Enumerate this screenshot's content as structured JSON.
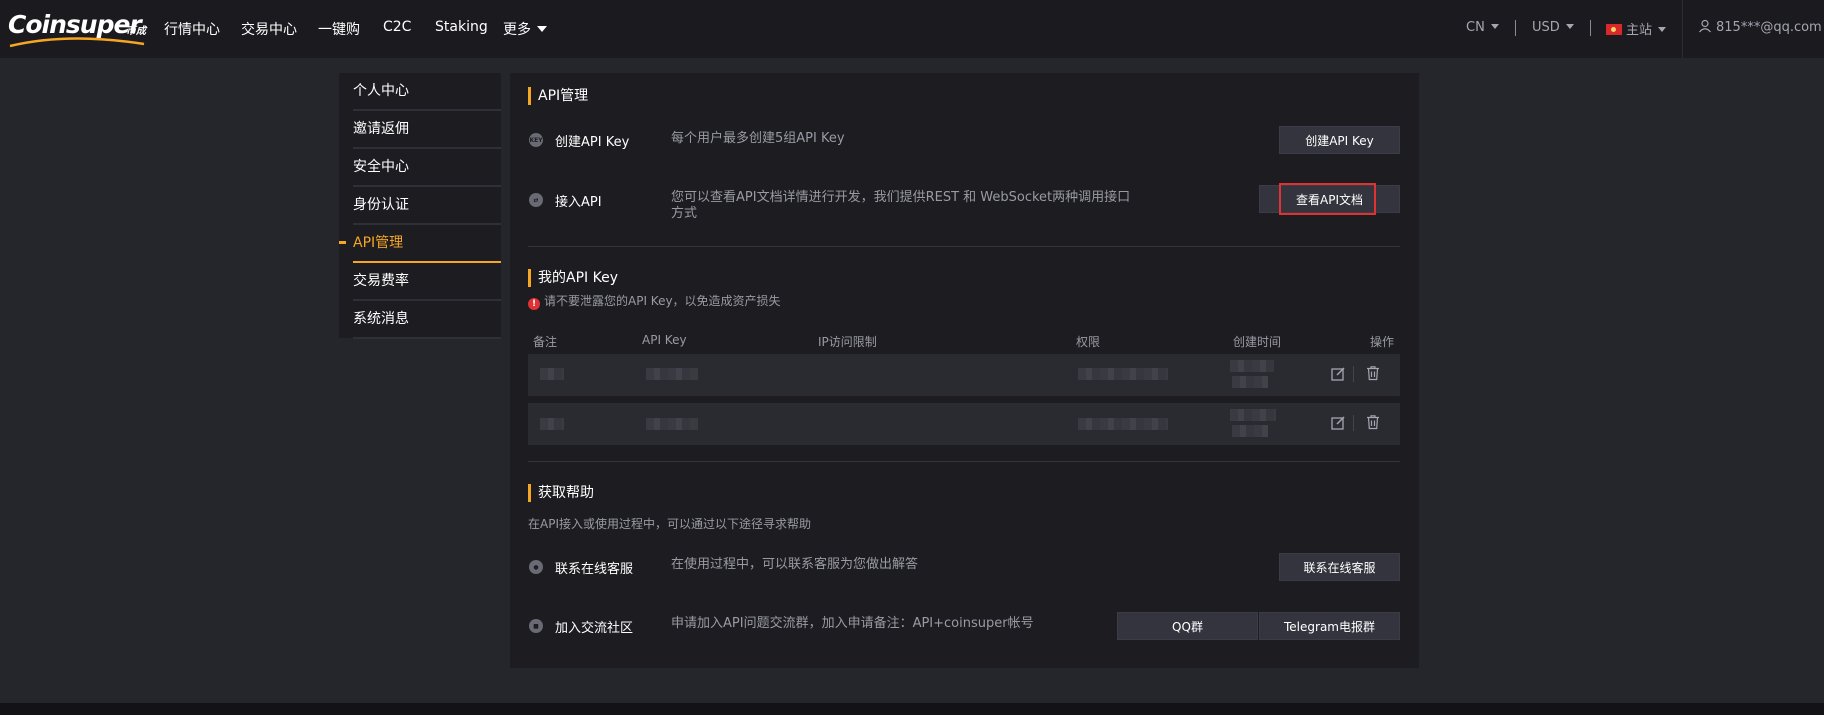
{
  "brand": {
    "logo_text": "Coinsuper",
    "logo_sub": "币成"
  },
  "nav": {
    "items": [
      "行情中心",
      "交易中心",
      "一键购",
      "C2C",
      "Staking",
      "更多"
    ],
    "language": "CN",
    "currency": "USD",
    "site": "主站",
    "user": "815***@qq.com"
  },
  "sidebar": {
    "items": [
      {
        "label": "个人中心"
      },
      {
        "label": "邀请返佣"
      },
      {
        "label": "安全中心"
      },
      {
        "label": "身份认证"
      },
      {
        "label": "API管理"
      },
      {
        "label": "交易费率"
      },
      {
        "label": "系统消息"
      }
    ],
    "active": "API管理"
  },
  "api_section": {
    "title": "API管理",
    "create": {
      "label": "创建API Key",
      "desc": "每个用户最多创建5组API Key",
      "button": "创建API Key"
    },
    "access": {
      "label": "接入API",
      "desc": "您可以查看API文档详情进行开发，我们提供REST 和 WebSocket两种调用接口方式",
      "button": "查看API文档"
    }
  },
  "my_keys": {
    "title": "我的API Key",
    "warning": "请不要泄露您的API Key，以免造成资产损失",
    "columns": [
      "备注",
      "API Key",
      "IP访问限制",
      "权限",
      "创建时间",
      "操作"
    ],
    "rows": [
      {
        "note": "",
        "key": "",
        "ip": "",
        "perm": "",
        "time": ""
      },
      {
        "note": "",
        "key": "",
        "ip": "",
        "perm": "",
        "time": ""
      }
    ]
  },
  "help": {
    "title": "获取帮助",
    "desc": "在API接入或使用过程中，可以通过以下途径寻求帮助",
    "support": {
      "label": "联系在线客服",
      "desc": "在使用过程中，可以联系客服为您做出解答",
      "button": "联系在线客服"
    },
    "community": {
      "label": "加入交流社区",
      "desc": "申请加入API问题交流群，加入申请备注：API+coinsuper帐号",
      "button_qq": "QQ群",
      "button_telegram": "Telegram电报群"
    }
  },
  "colors": {
    "accent": "#f5a623",
    "highlight": "#e03232",
    "panel": "#1c1c21",
    "page": "#25252c"
  }
}
